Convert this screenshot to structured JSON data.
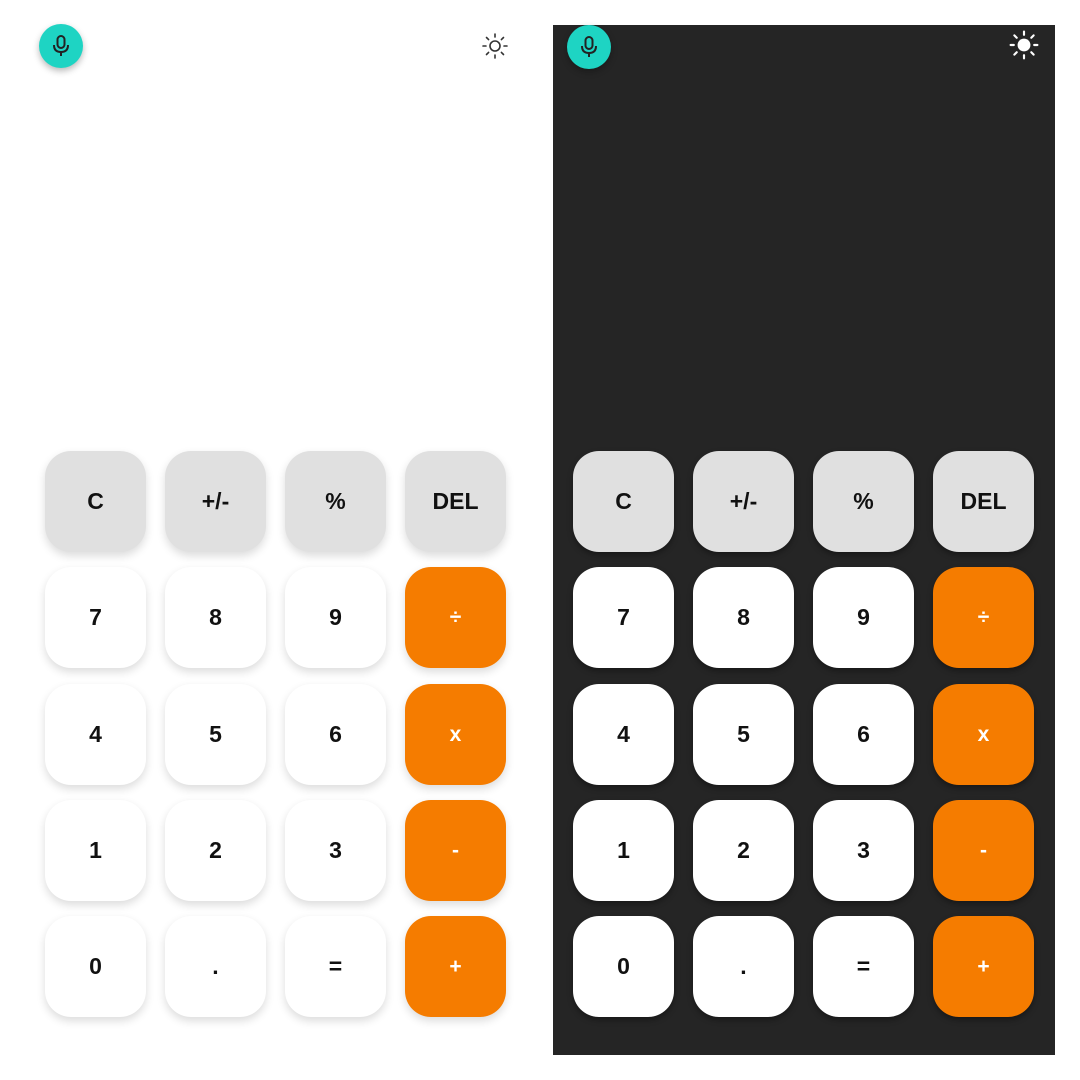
{
  "colors": {
    "mic_accent": "#1ed4c3",
    "operator_orange": "#f57c00",
    "function_key_gray": "#e0e0e0",
    "light_background": "#ffffff",
    "dark_background": "#252525"
  },
  "icons": {
    "mic": "microphone-icon",
    "theme_light_mode": "sun-outline-icon",
    "theme_dark_mode": "sun-filled-icon"
  },
  "light": {
    "keys": {
      "clear": "C",
      "toggle_sign": "+/-",
      "percent": "%",
      "delete": "DEL",
      "seven": "7",
      "eight": "8",
      "nine": "9",
      "divide": "÷",
      "four": "4",
      "five": "5",
      "six": "6",
      "multiply": "x",
      "one": "1",
      "two": "2",
      "three": "3",
      "subtract": "-",
      "zero": "0",
      "decimal": ".",
      "equals": "=",
      "add": "+"
    }
  },
  "dark": {
    "keys": {
      "clear": "C",
      "toggle_sign": "+/-",
      "percent": "%",
      "delete": "DEL",
      "seven": "7",
      "eight": "8",
      "nine": "9",
      "divide": "÷",
      "four": "4",
      "five": "5",
      "six": "6",
      "multiply": "x",
      "one": "1",
      "two": "2",
      "three": "3",
      "subtract": "-",
      "zero": "0",
      "decimal": ".",
      "equals": "=",
      "add": "+"
    }
  }
}
